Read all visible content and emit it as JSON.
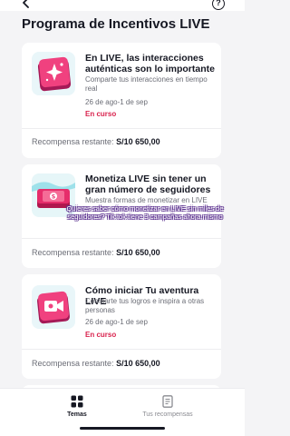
{
  "header": {
    "title": "Programa de Incentivos LIVE",
    "back_icon": "chevron-left-icon",
    "help_icon": "question-circle-icon",
    "help_glyph": "?"
  },
  "cards": [
    {
      "title": "En LIVE, las interacciones auténticas son lo importante",
      "description": "Comparte tus interacciones en tiempo real",
      "date": "26 de ago-1 de sep",
      "status": "En curso",
      "reward_label": "Recompensa restante:",
      "reward_value": "S/10 650,00",
      "icon": "sparkle-card-icon"
    },
    {
      "title": "Monetiza LIVE sin tener un gran número de seguidores",
      "description": "Muestra formas de monetizar en LIVE",
      "reward_label": "Recompensa restante:",
      "reward_value": "S/10 650,00",
      "icon": "money-stack-icon"
    },
    {
      "title": "Cómo iniciar Tu aventura LIVE",
      "description": "Comparte tus logros e inspira a otras personas",
      "date": "26 de ago-1 de sep",
      "status": "En curso",
      "reward_label": "Recompensa restante:",
      "reward_value": "S/10 650,00",
      "icon": "live-camera-icon"
    }
  ],
  "overlay_caption": "Quieres saber cómo monetizar en LIVE sin miles de seguidores? Tik tok tiene 3 campañas ahora mismo",
  "tabbar": {
    "tabs": [
      {
        "label": "Temas",
        "icon": "grid-icon",
        "active": true
      },
      {
        "label": "Tus recompensas",
        "icon": "document-list-icon",
        "active": false
      }
    ]
  },
  "colors": {
    "accent": "#d9224d",
    "background": "#f4f4f6",
    "card": "#ffffff",
    "text_primary": "#161823",
    "text_secondary": "#6b6d76"
  }
}
